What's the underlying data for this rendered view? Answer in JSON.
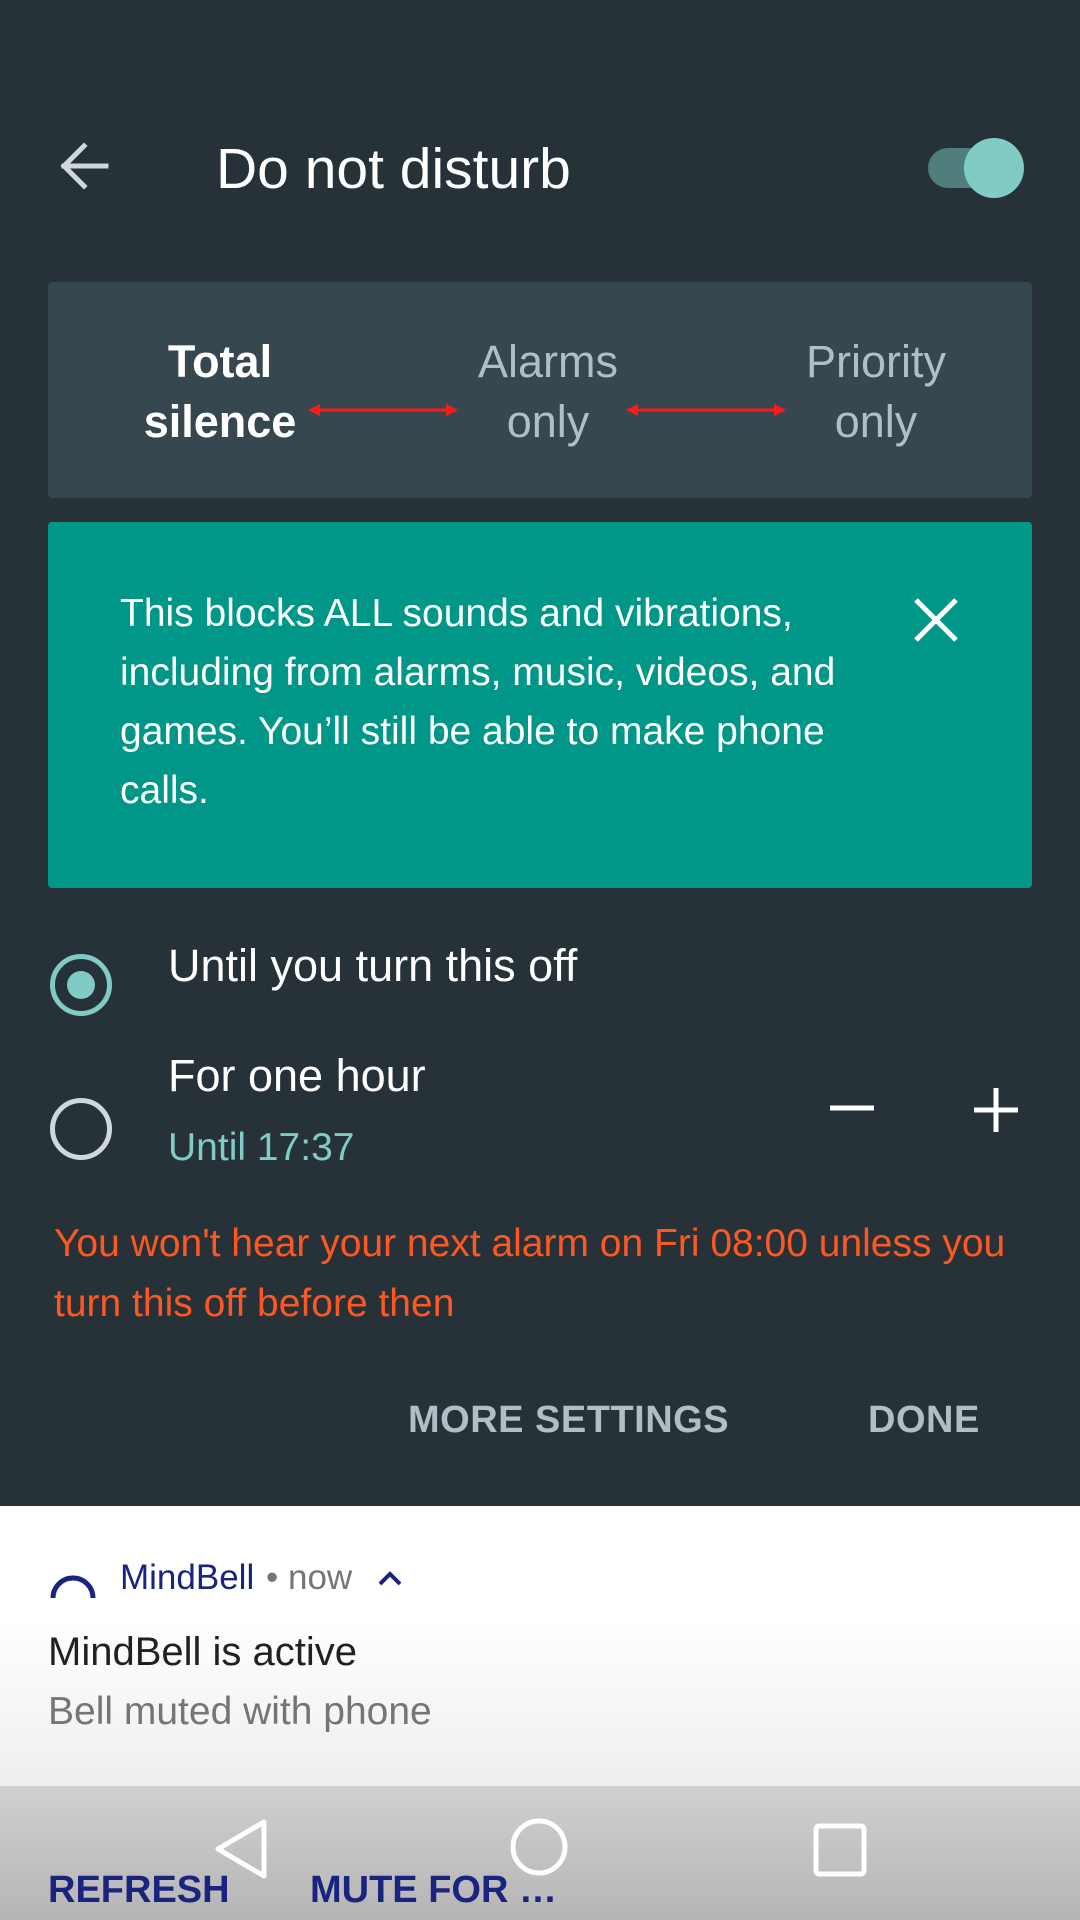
{
  "header": {
    "title": "Do not disturb",
    "toggle_on": true
  },
  "segments": {
    "options": [
      {
        "line1": "Total",
        "line2": "silence",
        "selected": true
      },
      {
        "line1": "Alarms",
        "line2": "only",
        "selected": false
      },
      {
        "line1": "Priority",
        "line2": "only",
        "selected": false
      }
    ]
  },
  "info_card": {
    "text": "This blocks ALL sounds and vibrations, including from alarms, music, videos, and games. You’ll still be able to make phone calls."
  },
  "duration": {
    "option1_label": "Until you turn this off",
    "option2_label": "For one hour",
    "option2_sub": "Until 17:37",
    "selected": "option1"
  },
  "warning": "You won't hear your next alarm on Fri 08:00 unless you turn this off before then",
  "buttons": {
    "more_settings": "MORE SETTINGS",
    "done": "DONE"
  },
  "notification": {
    "app_name": "MindBell",
    "time": "• now",
    "title": "MindBell is active",
    "subtitle": "Bell muted with phone",
    "actions": [
      "REFRESH",
      "MUTE FOR …"
    ]
  },
  "colors": {
    "background": "#263238",
    "accent": "#80cbc4",
    "info_card": "#009688",
    "warning": "#ff5722"
  }
}
